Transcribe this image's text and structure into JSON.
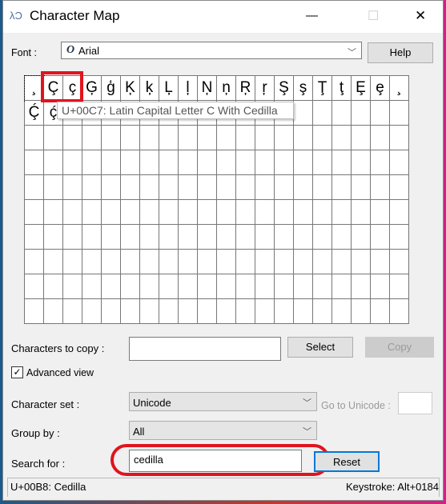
{
  "window": {
    "title": "Character Map",
    "minimize": "—",
    "maximize": "☐",
    "close": "✕"
  },
  "font": {
    "label": "Font :",
    "value": "Arial",
    "font_icon": "O",
    "help": "Help"
  },
  "grid": {
    "rows": [
      [
        "¸",
        "Ç",
        "ç",
        "Ģ",
        "ģ",
        "Ķ",
        "ķ",
        "Ļ",
        "ļ",
        "Ņ",
        "ņ",
        "Ŗ",
        "ŗ",
        "Ş",
        "ş",
        "Ţ",
        "ţ",
        "Ȩ",
        "ȩ",
        "¸"
      ],
      [
        "Ḉ",
        "ḉ"
      ]
    ],
    "total_rows": 10,
    "columns": 20
  },
  "tooltip": "U+00C7: Latin Capital Letter C With Cedilla",
  "copy": {
    "label": "Characters to copy :",
    "value": "",
    "select": "Select",
    "copy": "Copy"
  },
  "advanced": {
    "label": "Advanced view",
    "checked": true
  },
  "charset": {
    "label": "Character set :",
    "value": "Unicode",
    "goto_label": "Go to Unicode :",
    "goto_value": ""
  },
  "groupby": {
    "label": "Group by :",
    "value": "All"
  },
  "search": {
    "label": "Search for :",
    "value": "cedilla",
    "reset": "Reset"
  },
  "status": {
    "left": "U+00B8: Cedilla",
    "right": "Keystroke: Alt+0184"
  },
  "colors": {
    "highlight": "#e0141e",
    "focus": "#0078d7"
  }
}
